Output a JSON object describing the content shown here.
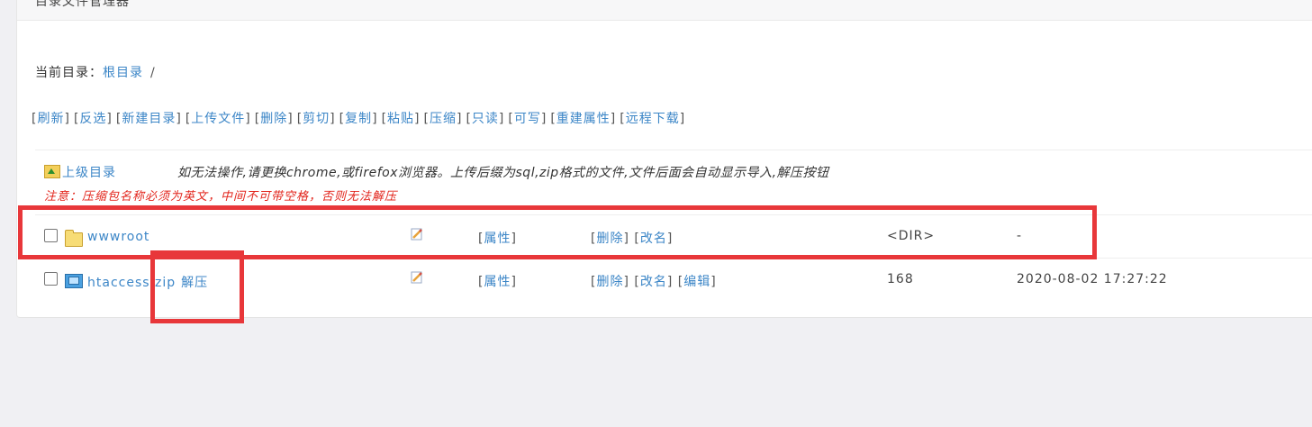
{
  "header": {
    "title": "目录文件管理器"
  },
  "current_dir": {
    "label": "当前目录：",
    "root": "根目录",
    "sep": "/"
  },
  "toolbar": [
    {
      "key": "refresh",
      "label": "刷新"
    },
    {
      "key": "invert",
      "label": "反选"
    },
    {
      "key": "newdir",
      "label": "新建目录"
    },
    {
      "key": "upload",
      "label": "上传文件"
    },
    {
      "key": "delete",
      "label": "删除"
    },
    {
      "key": "cut",
      "label": "剪切"
    },
    {
      "key": "copy",
      "label": "复制"
    },
    {
      "key": "paste",
      "label": "粘贴"
    },
    {
      "key": "compress",
      "label": "压缩"
    },
    {
      "key": "readonly",
      "label": "只读"
    },
    {
      "key": "writable",
      "label": "可写"
    },
    {
      "key": "reset_attr",
      "label": "重建属性"
    },
    {
      "key": "remote_download",
      "label": "远程下载"
    }
  ],
  "updir": {
    "label": "上级目录"
  },
  "tip": "如无法操作,请更换chrome,或firefox浏览器。上传后缀为sql,zip格式的文件,文件后面会自动显示导入,解压按钮",
  "warning": "注意：压缩包名称必须为英文，中间不可带空格，否则无法解压",
  "rows": [
    {
      "name": "wwwroot",
      "type": "folder",
      "attr": "属性",
      "actions": [
        "删除",
        "改名"
      ],
      "size": "<DIR>",
      "mtime": "-"
    },
    {
      "name": "htaccess.zip",
      "type": "zip",
      "extra": "解压",
      "attr": "属性",
      "actions": [
        "删除",
        "改名",
        "编辑"
      ],
      "size": "168",
      "mtime": "2020-08-02 17:27:22"
    }
  ],
  "colors": {
    "link": "#3c86c7",
    "warning": "#e2231a",
    "highlight": "#e8373a"
  }
}
